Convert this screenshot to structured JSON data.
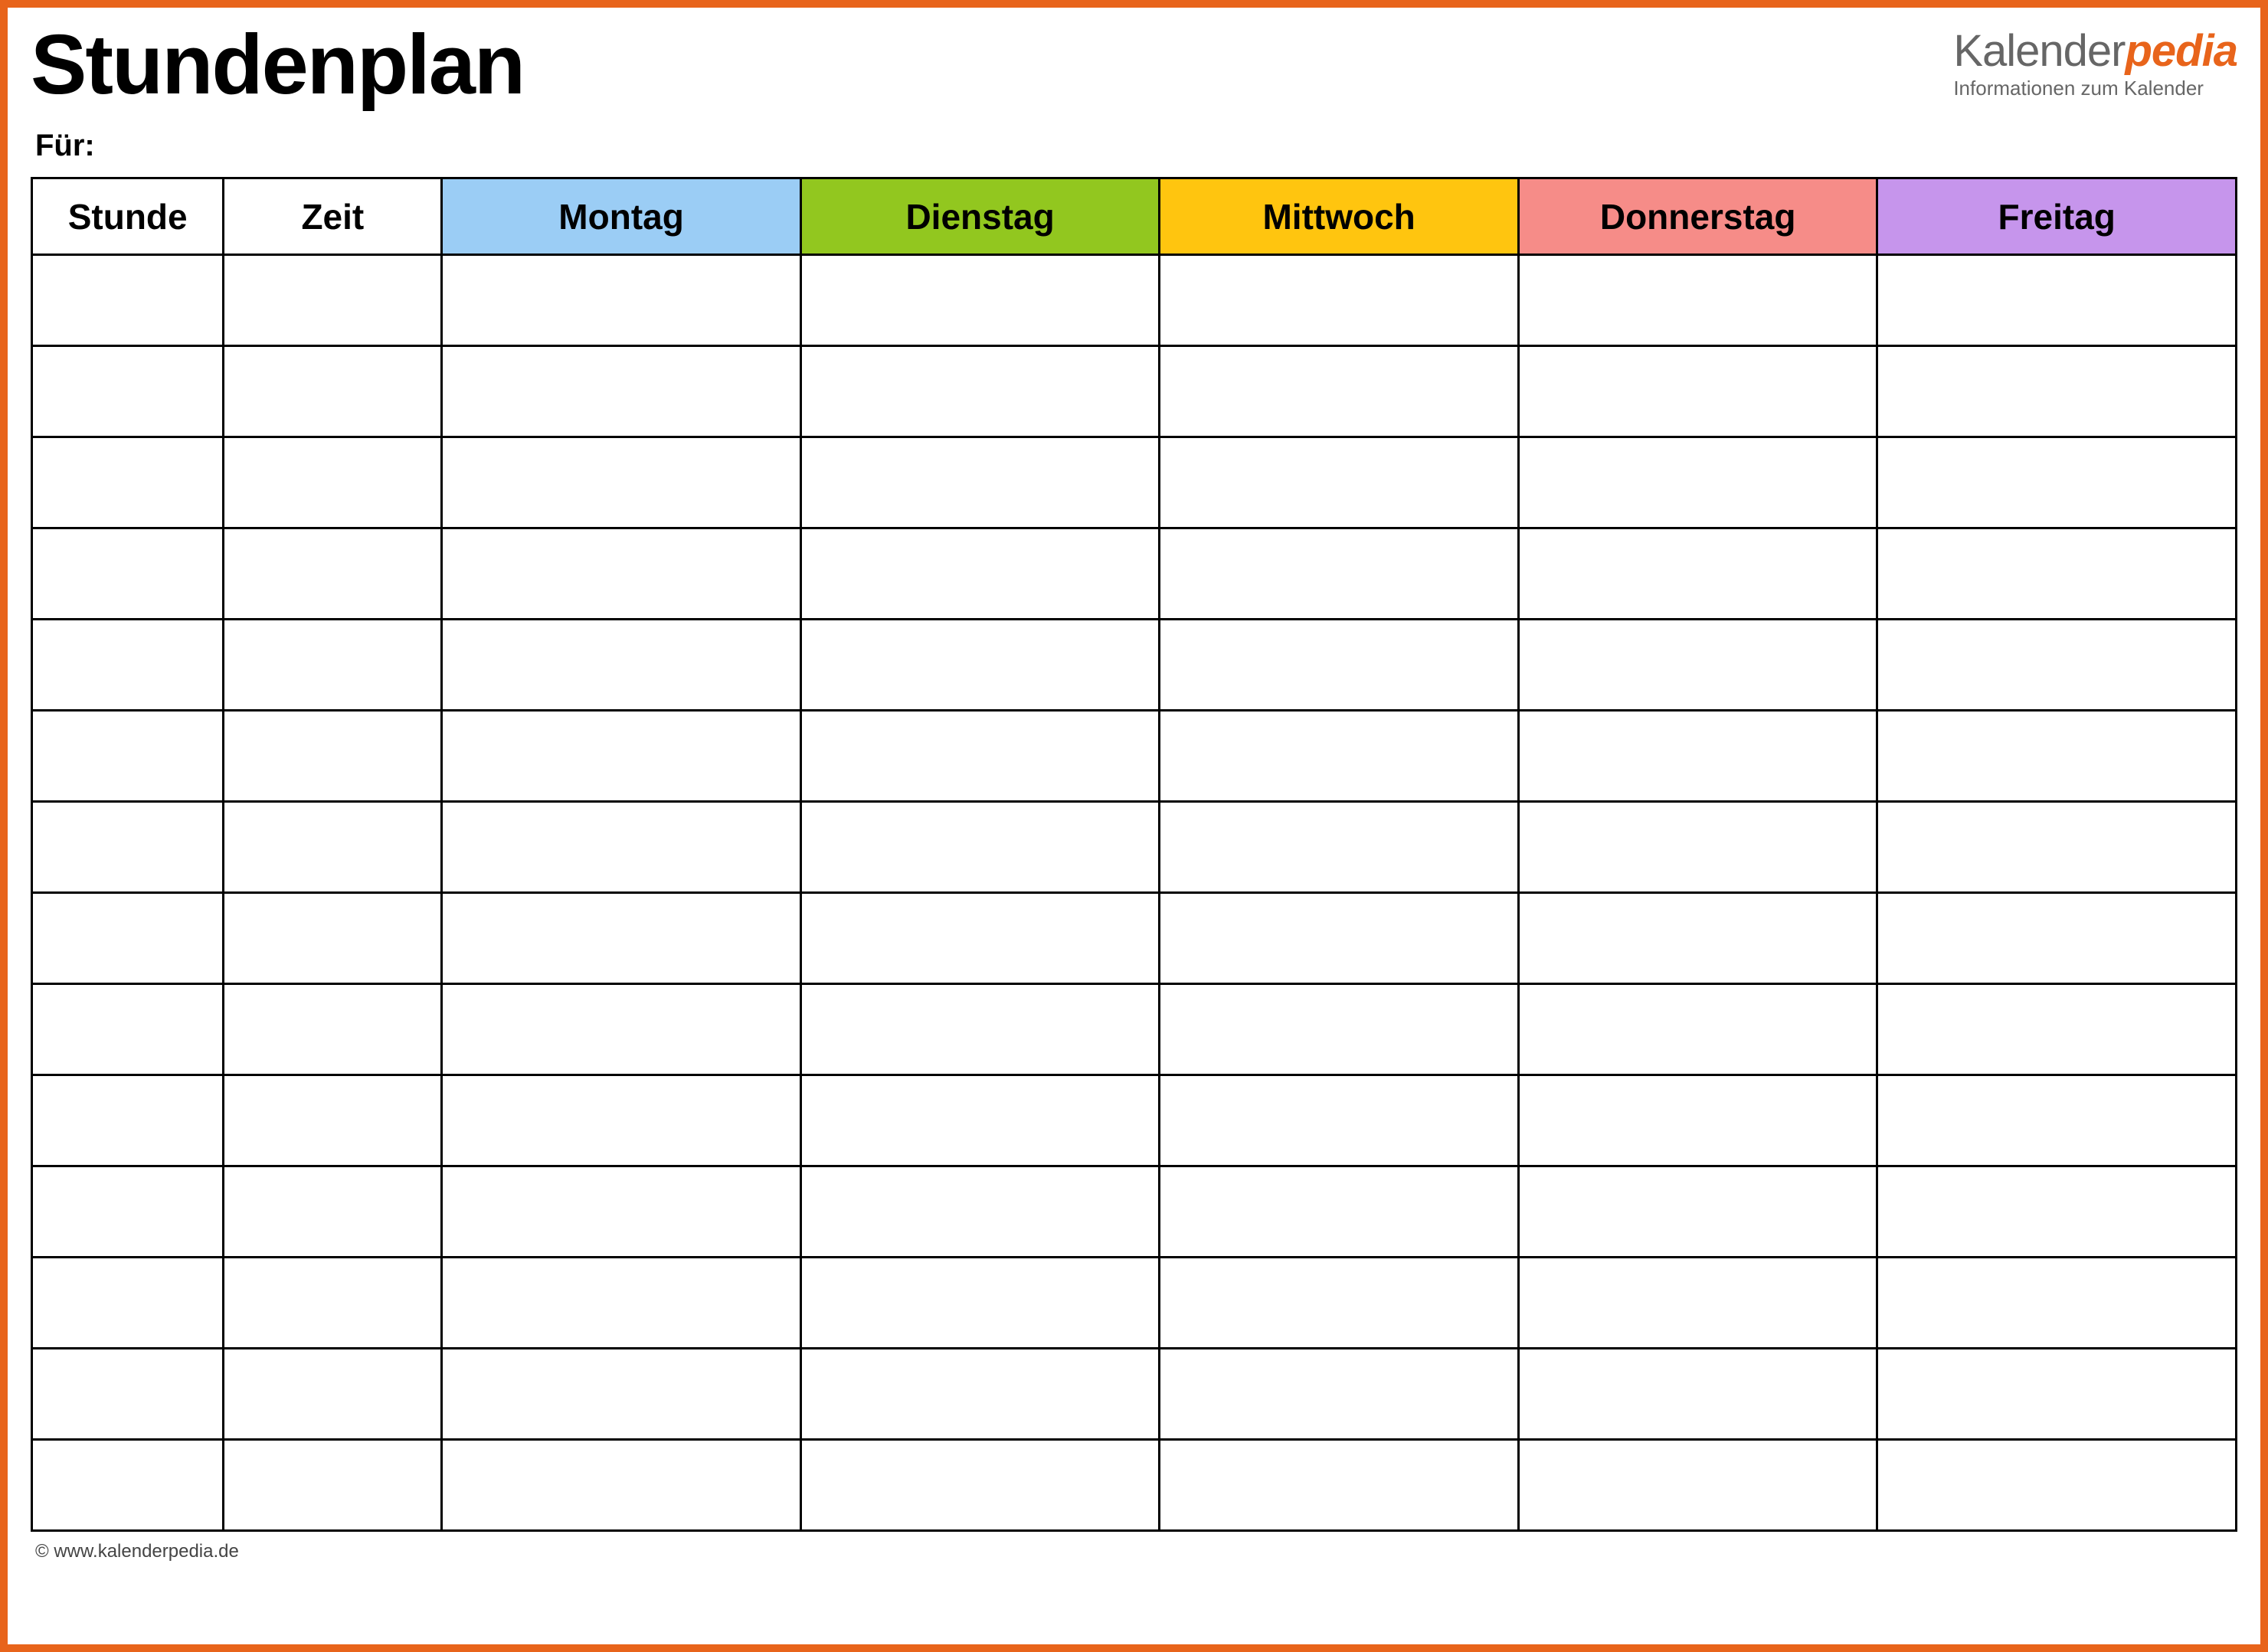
{
  "header": {
    "title": "Stundenplan",
    "for_label": "Für:"
  },
  "brand": {
    "name_part1": "Kalender",
    "name_part2": "pedia",
    "tagline": "Informationen zum Kalender"
  },
  "table": {
    "columns": {
      "hour": "Stunde",
      "time": "Zeit",
      "days": [
        "Montag",
        "Dienstag",
        "Mittwoch",
        "Donnerstag",
        "Freitag"
      ]
    },
    "day_colors": [
      "#9bcdf5",
      "#92c71f",
      "#ffc50f",
      "#f68c88",
      "#c695ec"
    ],
    "rows": [
      {
        "hour": "",
        "time": "",
        "cells": [
          "",
          "",
          "",
          "",
          ""
        ]
      },
      {
        "hour": "",
        "time": "",
        "cells": [
          "",
          "",
          "",
          "",
          ""
        ]
      },
      {
        "hour": "",
        "time": "",
        "cells": [
          "",
          "",
          "",
          "",
          ""
        ]
      },
      {
        "hour": "",
        "time": "",
        "cells": [
          "",
          "",
          "",
          "",
          ""
        ]
      },
      {
        "hour": "",
        "time": "",
        "cells": [
          "",
          "",
          "",
          "",
          ""
        ]
      },
      {
        "hour": "",
        "time": "",
        "cells": [
          "",
          "",
          "",
          "",
          ""
        ]
      },
      {
        "hour": "",
        "time": "",
        "cells": [
          "",
          "",
          "",
          "",
          ""
        ]
      },
      {
        "hour": "",
        "time": "",
        "cells": [
          "",
          "",
          "",
          "",
          ""
        ]
      },
      {
        "hour": "",
        "time": "",
        "cells": [
          "",
          "",
          "",
          "",
          ""
        ]
      },
      {
        "hour": "",
        "time": "",
        "cells": [
          "",
          "",
          "",
          "",
          ""
        ]
      },
      {
        "hour": "",
        "time": "",
        "cells": [
          "",
          "",
          "",
          "",
          ""
        ]
      },
      {
        "hour": "",
        "time": "",
        "cells": [
          "",
          "",
          "",
          "",
          ""
        ]
      },
      {
        "hour": "",
        "time": "",
        "cells": [
          "",
          "",
          "",
          "",
          ""
        ]
      },
      {
        "hour": "",
        "time": "",
        "cells": [
          "",
          "",
          "",
          "",
          ""
        ]
      }
    ]
  },
  "footer": {
    "site": "© www.kalenderpedia.de"
  }
}
